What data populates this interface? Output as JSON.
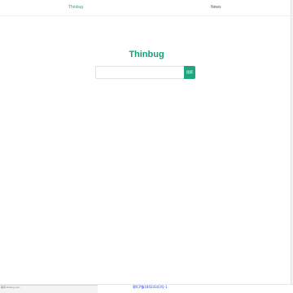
{
  "nav": {
    "brand": "Thinbug",
    "links": [
      "News"
    ]
  },
  "hero": {
    "title": "Thinbug"
  },
  "search": {
    "placeholder": "",
    "value": "",
    "button_label": "搜索"
  },
  "footer": {
    "status_text": "等待 thinbug.com...",
    "icp_text": "鄂ICP备18024343号-1"
  },
  "colors": {
    "brand": "#14a07a",
    "button": "#1ea683",
    "footer_link": "#2350d8"
  }
}
